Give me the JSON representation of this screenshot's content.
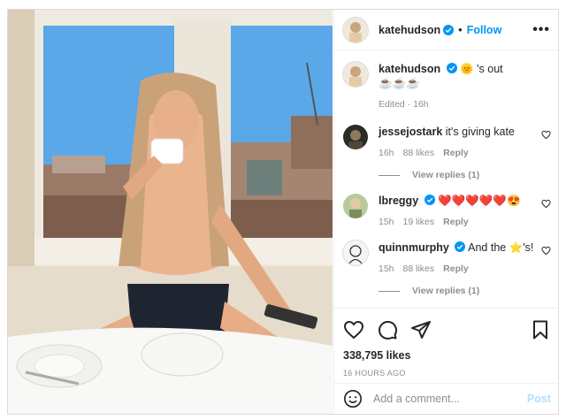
{
  "post": {
    "author": "katehudson",
    "follow_label": "Follow",
    "more_label": "•••",
    "photo_alt": ""
  },
  "caption": {
    "username": "katehudson",
    "text": "🌞 's out",
    "line2": "☕☕☕",
    "edited": "Edited · 16h"
  },
  "comments": [
    {
      "username": "jessejostark",
      "verified": false,
      "text": "it's giving kate",
      "time": "16h",
      "likes": "88 likes",
      "reply": "Reply",
      "view_replies": "View replies (1)"
    },
    {
      "username": "lbreggy",
      "verified": true,
      "text": "❤️❤️❤️❤️❤️😍",
      "time": "15h",
      "likes": "19 likes",
      "reply": "Reply",
      "view_replies": ""
    },
    {
      "username": "quinnmurphy",
      "verified": true,
      "text": "And the ⭐'s!",
      "time": "15h",
      "likes": "88 likes",
      "reply": "Reply",
      "view_replies": "View replies (1)"
    }
  ],
  "engagement": {
    "likes": "338,795 likes",
    "time": "16 HOURS AGO"
  },
  "composer": {
    "placeholder": "Add a comment...",
    "post_label": "Post"
  },
  "colors": {
    "accent": "#0095f6",
    "verified": "#0095f6",
    "muted": "#8e8e8e",
    "post_disabled": "#b2dffc"
  },
  "icons": {
    "like": "heart-icon",
    "comment": "comment-icon",
    "share": "paper-plane-icon",
    "save": "bookmark-icon",
    "emoji": "smiley-icon",
    "more": "more-icon",
    "verified": "verified-badge-icon"
  }
}
